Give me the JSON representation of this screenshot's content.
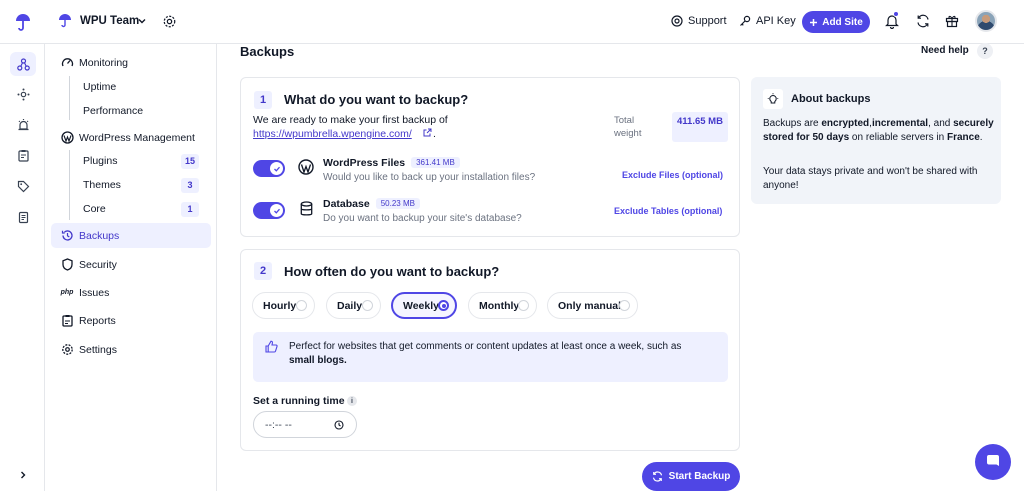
{
  "header": {
    "team_name": "WPU Team",
    "support_label": "Support",
    "api_key_label": "API Key",
    "add_site_label": "Add Site"
  },
  "sidebar": {
    "monitoring": "Monitoring",
    "uptime": "Uptime",
    "performance": "Performance",
    "wp_management": "WordPress Management",
    "plugins": "Plugins",
    "plugins_count": "15",
    "themes": "Themes",
    "themes_count": "3",
    "core": "Core",
    "core_count": "1",
    "backups": "Backups",
    "security": "Security",
    "issues": "Issues",
    "issues_icon_text": "php",
    "reports": "Reports",
    "settings": "Settings"
  },
  "page": {
    "title": "Backups",
    "need_help": "Need help",
    "help_q": "?"
  },
  "step1": {
    "num": "1",
    "title": "What do you want to backup?",
    "intro": "We are ready to make your first backup of",
    "site_url": "https://wpumbrella.wpengine.com/",
    "url_suffix": ".",
    "total_weight_label": "Total weight",
    "total_weight_value": "411.65 MB",
    "files_title": "WordPress Files",
    "files_size": "361.41 MB",
    "files_desc": "Would you like to back up your installation files?",
    "files_link": "Exclude Files (optional)",
    "db_title": "Database",
    "db_size": "50.23 MB",
    "db_desc": "Do you want to backup your site's database?",
    "db_link": "Exclude Tables (optional)"
  },
  "step2": {
    "num": "2",
    "title": "How often do you want to backup?",
    "options": [
      "Hourly",
      "Daily",
      "Weekly",
      "Monthly",
      "Only manual"
    ],
    "selected": "Weekly",
    "info_text": "Perfect for websites that get comments or content updates at least once a week, such as",
    "info_bold": "small blogs.",
    "running_time_label": "Set a running time",
    "running_time_placeholder": "--:-- --"
  },
  "start_backup_label": "Start Backup",
  "about": {
    "title": "About backups",
    "p1_a": "Backups are ",
    "p1_b": "encrypted",
    "p1_c": ",",
    "p1_d": "incremental",
    "p1_e": ", and ",
    "p1_f": "securely stored for 50 days",
    "p1_g": " on reliable servers in ",
    "p1_h": "France",
    "p1_i": ".",
    "p2": "Your data stays private and won't be shared with anyone!"
  },
  "colors": {
    "accent": "#4f46e5",
    "accent_soft": "#eef0ff"
  }
}
